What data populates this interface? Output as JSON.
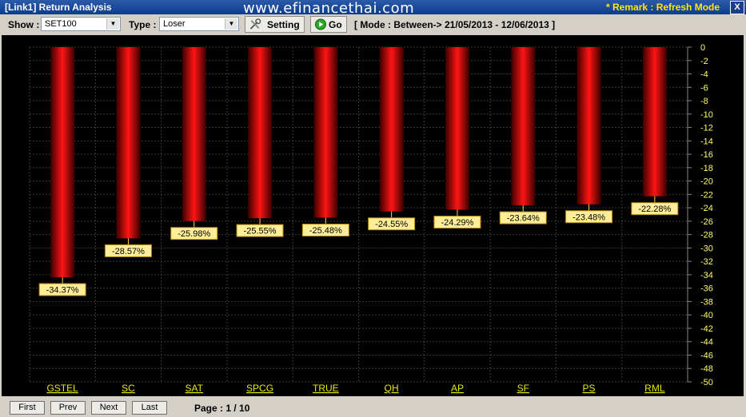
{
  "window": {
    "title": "[Link1] Return Analysis",
    "watermark": "www.efinancethai.com",
    "remark": "* Remark : Refresh Mode",
    "close_label": "X"
  },
  "toolbar": {
    "show_label": "Show :",
    "show_value": "SET100",
    "type_label": "Type :",
    "type_value": "Loser",
    "setting_label": "Setting",
    "go_label": "Go",
    "mode_text": "[ Mode : Between-> 21/05/2013 - 12/06/2013 ]"
  },
  "pager": {
    "first": "First",
    "prev": "Prev",
    "next": "Next",
    "last": "Last",
    "page_info": "Page : 1 / 10"
  },
  "colors": {
    "bar_dark": "#4a0000",
    "bar_bright": "#ff1a1a",
    "label_bg": "#ffee99",
    "axis_text": "#ffff66",
    "grid": "#3a3a3a",
    "category_text": "#e8e800"
  },
  "chart_data": {
    "type": "bar",
    "categories": [
      "GSTEL",
      "SC",
      "SAT",
      "SPCG",
      "TRUE",
      "QH",
      "AP",
      "SF",
      "PS",
      "RML"
    ],
    "values": [
      -34.37,
      -28.57,
      -25.98,
      -25.55,
      -25.48,
      -24.55,
      -24.29,
      -23.64,
      -23.48,
      -22.28
    ],
    "value_labels": [
      "-34.37%",
      "-28.57%",
      "-25.98%",
      "-25.55%",
      "-25.48%",
      "-24.55%",
      "-24.29%",
      "-23.64%",
      "-23.48%",
      "-22.28%"
    ],
    "ylim": [
      -50,
      0
    ],
    "yticks": [
      0,
      -2,
      -4,
      -6,
      -8,
      -10,
      -12,
      -14,
      -16,
      -18,
      -20,
      -22,
      -24,
      -26,
      -28,
      -30,
      -32,
      -34,
      -36,
      -38,
      -40,
      -42,
      -44,
      -46,
      -48,
      -50
    ],
    "y_axis_position": "right",
    "grid": true
  }
}
